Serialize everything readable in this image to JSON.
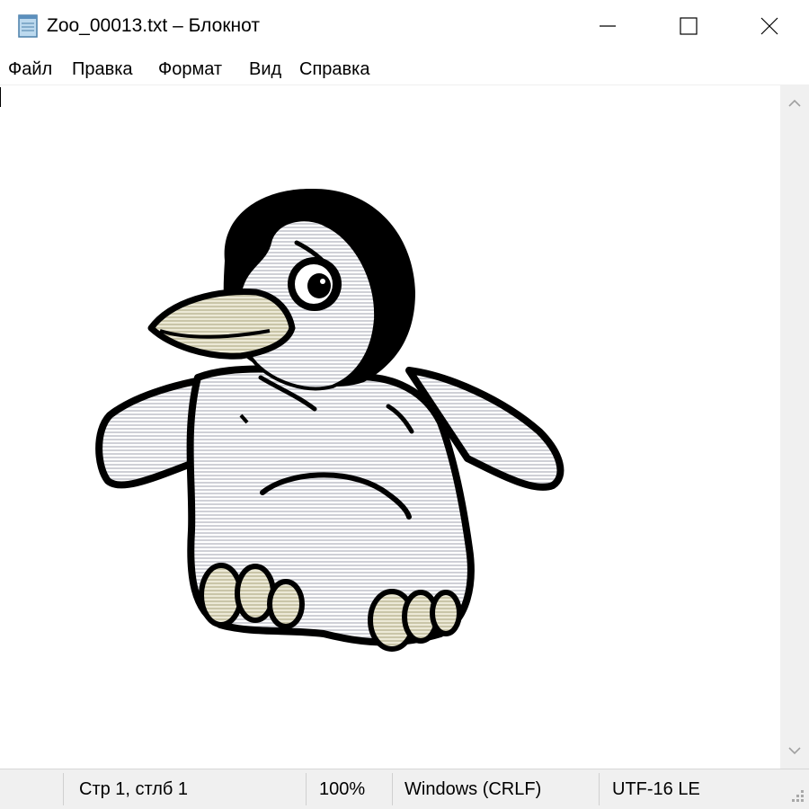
{
  "window": {
    "title": "Zoo_00013.txt – Блокнот",
    "controls": [
      "minimize",
      "maximize",
      "close"
    ]
  },
  "menu": {
    "items": [
      "Файл",
      "Правка",
      "Формат",
      "Вид",
      "Справка"
    ]
  },
  "editor": {
    "content": "ASCII-art penguin drawing",
    "icons": [
      "notepad-icon",
      "penguin-art"
    ]
  },
  "status": {
    "position": "Стр 1, стлб 1",
    "zoom": "100%",
    "line_endings": "Windows (CRLF)",
    "encoding": "UTF-16 LE"
  },
  "colors": {
    "menu_bg": "#ffffff",
    "status_bg": "#f0f0f0",
    "penguin_black": "#000000",
    "penguin_body": "#dcdde2",
    "penguin_beak": "#d9d6bd"
  }
}
